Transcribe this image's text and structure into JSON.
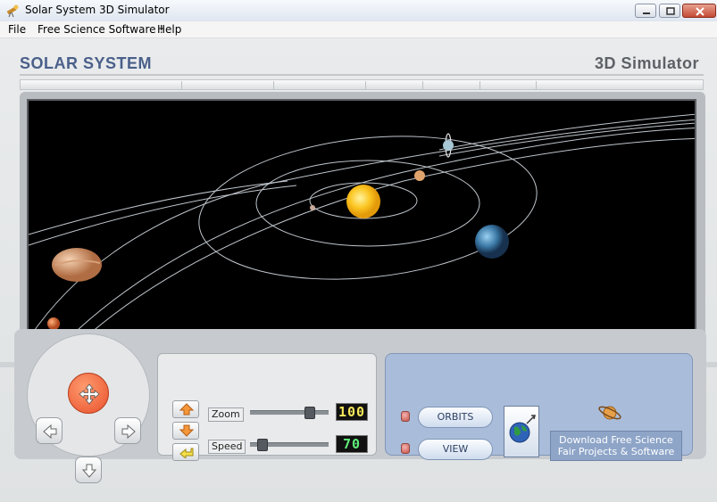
{
  "window": {
    "title": "Solar System 3D Simulator"
  },
  "menu": {
    "items": [
      "File",
      "Free Science Software !",
      "Help"
    ]
  },
  "header": {
    "left_title": "SOLAR SYSTEM",
    "right_title": "3D Simulator"
  },
  "controls": {
    "zoom": {
      "label": "Zoom",
      "display": "100",
      "level": 0.8
    },
    "speed": {
      "label": "Speed",
      "display": "70",
      "level": 0.1
    }
  },
  "options": {
    "orbits_label": "ORBITS",
    "view_label": "VIEW",
    "download_line1": "Download Free Science",
    "download_line2": "Fair Projects & Software"
  },
  "colors": {
    "header_accent": "#4a5f8a",
    "lcd_zoom": "#f7e85a",
    "lcd_speed": "#5ff07a",
    "center_button": "#e8502b"
  },
  "icons": {
    "app": "telescope-icon",
    "dpad_up": "arrow-up-icon",
    "dpad_down": "arrow-down-icon",
    "dpad_left": "arrow-left-icon",
    "dpad_right": "arrow-right-icon",
    "dpad_center": "move-icon",
    "view_toggle": "globe-icon",
    "download": "saturn-icon"
  }
}
